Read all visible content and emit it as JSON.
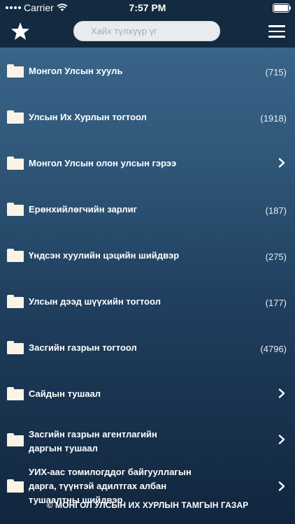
{
  "status_bar": {
    "carrier": "Carrier",
    "time": "7:57 PM"
  },
  "nav_bar": {
    "star_icon": "star-icon",
    "search_placeholder": "Хайх түлхүүр үг",
    "menu_icon": "hamburger-menu-icon"
  },
  "rows": [
    {
      "label": "Монгол Улсын хууль",
      "count": "(715)"
    },
    {
      "label": "Улсын Их Хурлын тогтоол",
      "count": "(1918)"
    },
    {
      "label": "Монгол Улсын олон улсын гэрээ",
      "chevron": true
    },
    {
      "label": "Ерөнхийлөгчийн зарлиг",
      "count": "(187)"
    },
    {
      "label": "Үндсэн хуулийн цэцийн шийдвэр",
      "count": "(275)"
    },
    {
      "label": "Улсын дээд шүүхийн тогтоол",
      "count": "(177)"
    },
    {
      "label": "Засгийн газрын тогтоол",
      "count": "(4796)"
    },
    {
      "label": "Сайдын тушаал",
      "chevron": true
    },
    {
      "label_lines": [
        "Засгийн газрын агентлагийн",
        "даргын тушаал"
      ],
      "chevron": true
    },
    {
      "label_lines": [
        "УИХ-аас томилогддог байгууллагын",
        "дарга, түүнтэй адилтгах албан",
        "тушаалтны шийдвэр"
      ],
      "chevron": true
    }
  ],
  "footer": "© МОНГОЛ УЛСЫН ИХ ХУРЛЫН ТАМГЫН ГАЗАР",
  "colors": {
    "bar": "#132a40",
    "folder": "#fbf3e4",
    "text": "#ffffff"
  }
}
